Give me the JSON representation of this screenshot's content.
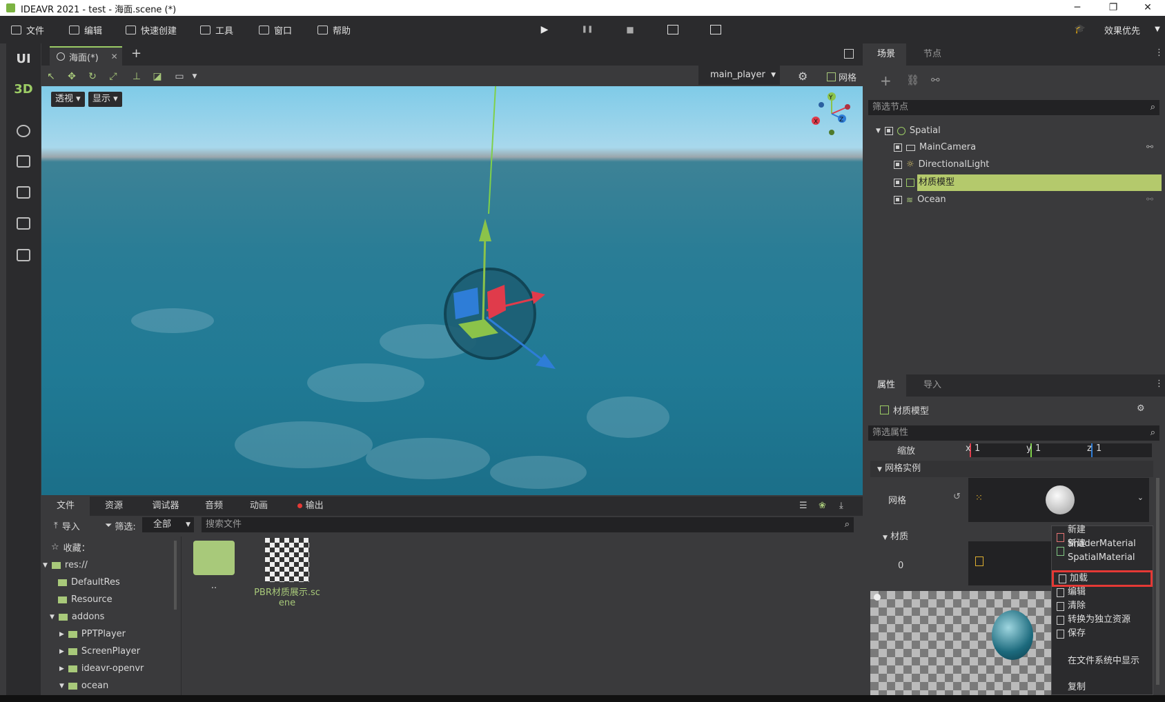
{
  "window": {
    "title": "IDEAVR 2021 - test - 海面.scene (*)",
    "min": "─",
    "max": "❐",
    "close": "✕"
  },
  "menu": {
    "items": [
      "文件",
      "编辑",
      "快速创建",
      "工具",
      "窗口",
      "帮助"
    ],
    "quality": "效果优先"
  },
  "playbar": {
    "play": "▶",
    "pause": "❚❚",
    "stop": "■"
  },
  "leftbar": {
    "ui": "UI",
    "three_d": "3D"
  },
  "editor": {
    "tab_label": "海面(*)",
    "tab_close": "✕",
    "add_tab": "+",
    "player_select": "main_player",
    "grid_label": "网格",
    "perspective_btn": "透视",
    "display_btn": "显示",
    "gizmo": {
      "y": "Y",
      "z": "Z",
      "x": "X"
    }
  },
  "scene_panel": {
    "tabs": [
      "场景",
      "节点"
    ],
    "filter_placeholder": "筛选节点",
    "tree": [
      "Spatial",
      "MainCamera",
      "DirectionalLight",
      "材质模型",
      "Ocean"
    ]
  },
  "inspector": {
    "tabs": [
      "属性",
      "导入"
    ],
    "node_name": "材质模型",
    "filter_placeholder": "筛选属性",
    "scale_label": "缩放",
    "scale": {
      "x_label": "x",
      "x": "1",
      "y_label": "y",
      "y": "1",
      "z_label": "z",
      "z": "1"
    },
    "section_mesh_instance": "网格实例",
    "mesh_label": "网格",
    "material_section": "材质",
    "material_index": "0"
  },
  "context_menu": {
    "items": [
      "新建ShaderMaterial",
      "新建SpatialMaterial",
      "加载",
      "编辑",
      "清除",
      "转换为独立资源",
      "保存",
      "在文件系统中显示",
      "复制"
    ],
    "highlight_color": "#e53935"
  },
  "bottom": {
    "tabs": [
      "文件",
      "资源",
      "调试器",
      "音频",
      "动画",
      "输出"
    ],
    "import_label": "导入",
    "filter_label": "筛选:",
    "filter_value": "全部",
    "search_placeholder": "搜索文件",
    "fav_label": "收藏：",
    "tree": [
      "res://",
      "DefaultRes",
      "Resource",
      "addons",
      "PPTPlayer",
      "ScreenPlayer",
      "ideavr-openvr",
      "ocean"
    ],
    "files": [
      {
        "name": ".."
      },
      {
        "name": "PBR材质展示.scene"
      }
    ]
  },
  "colors": {
    "accent": "#9ccc65",
    "selected_row": "#b4c96c",
    "record_dot": "#e53935"
  }
}
